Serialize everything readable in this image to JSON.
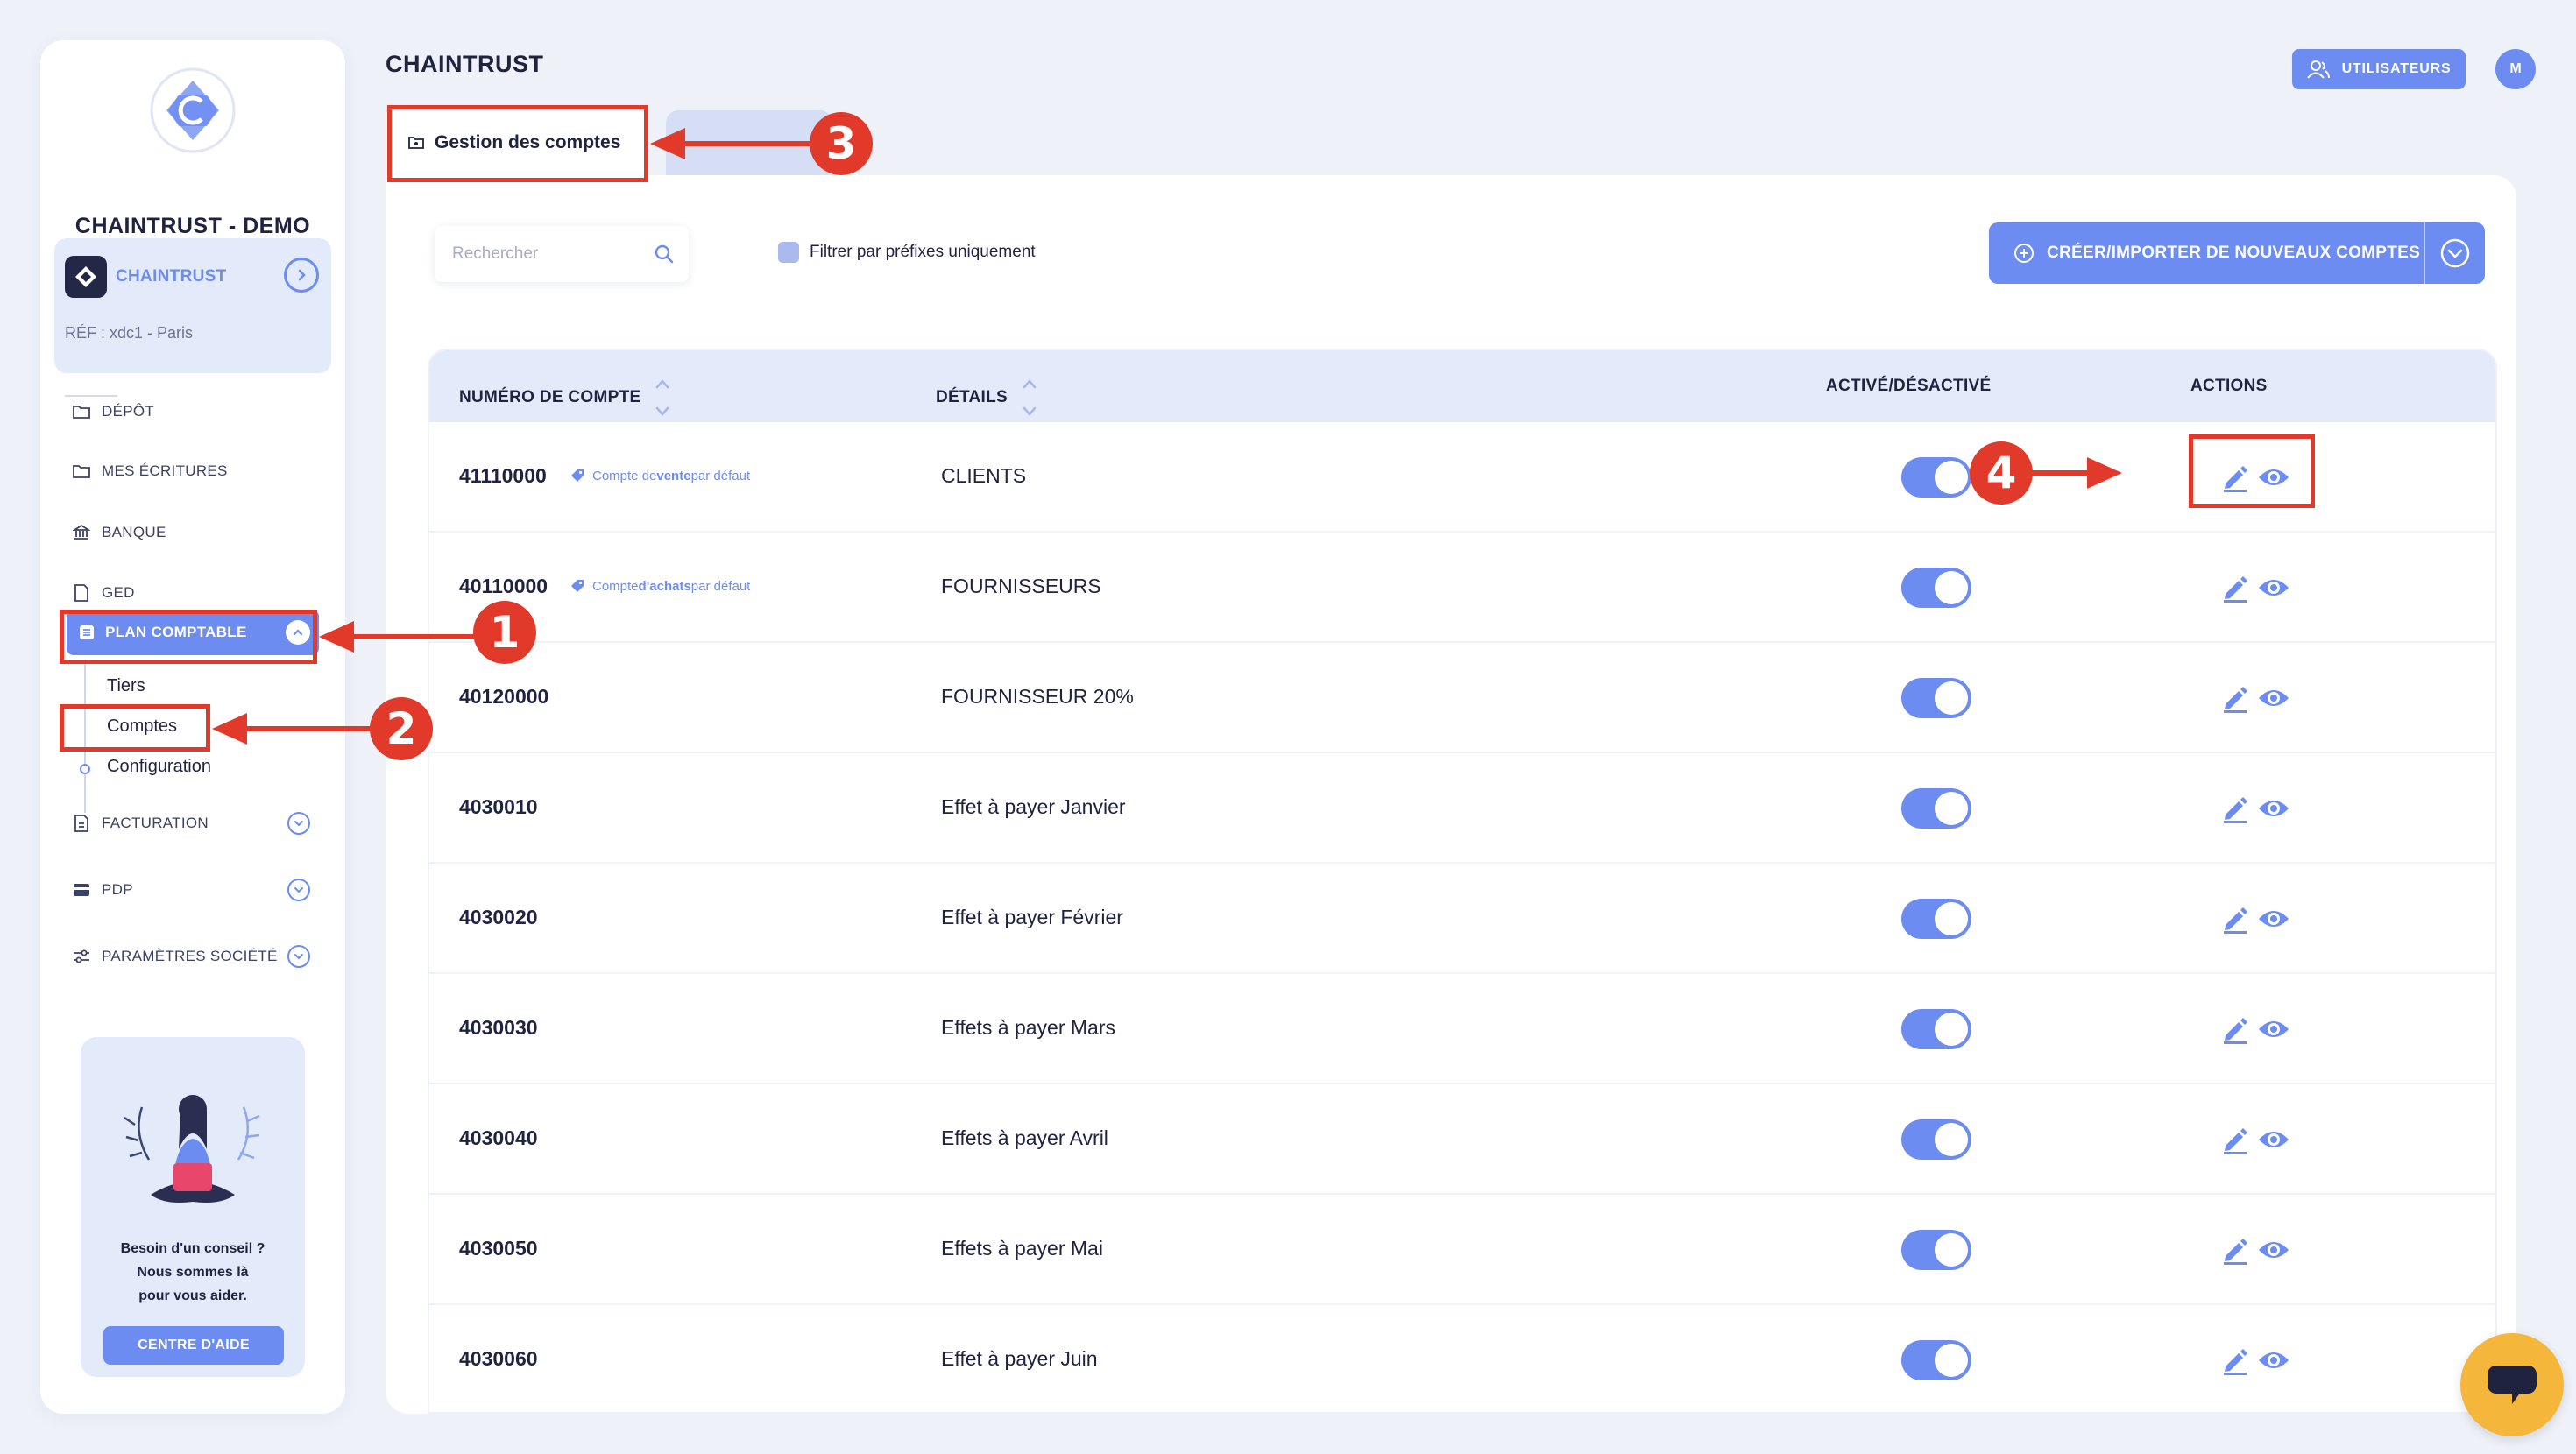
{
  "sidebar": {
    "company_name": "CHAINTRUST - DEMO",
    "org": {
      "name": "CHAINTRUST",
      "ref": "RÉF : xdc1 - Paris"
    },
    "nav": [
      {
        "label": "DÉPÔT",
        "icon": "folder-icon"
      },
      {
        "label": "MES ÉCRITURES",
        "icon": "folder-icon"
      },
      {
        "label": "BANQUE",
        "icon": "bank-icon"
      },
      {
        "label": "GED",
        "icon": "document-icon"
      },
      {
        "label": "PLAN COMPTABLE",
        "icon": "ledger-icon"
      },
      {
        "label": "FACTURATION",
        "icon": "invoice-icon"
      },
      {
        "label": "PDP",
        "icon": "card-icon"
      },
      {
        "label": "PARAMÈTRES SOCIÉTÉ",
        "icon": "sliders-icon"
      }
    ],
    "sub_items": [
      "Tiers",
      "Comptes",
      "Configuration"
    ],
    "help": {
      "line1": "Besoin d'un conseil ?",
      "line2": "Nous sommes là",
      "line3": "pour vous aider.",
      "button": "CENTRE D'AIDE"
    }
  },
  "header": {
    "title": "CHAINTRUST",
    "users_button": "UTILISATEURS",
    "avatar_initial": "M"
  },
  "tabs": {
    "active": "Gestion des comptes"
  },
  "toolbar": {
    "search_placeholder": "Rechercher",
    "filter_label": "Filtrer par préfixes uniquement",
    "create_button": "CRÉER/IMPORTER DE NOUVEAUX COMPTES"
  },
  "table": {
    "headers": {
      "account_number": "NUMÉRO DE COMPTE",
      "details": "DÉTAILS",
      "active": "ACTIVÉ/DÉSACTIVÉ",
      "actions": "ACTIONS"
    },
    "rows": [
      {
        "number": "41110000",
        "tag_prefix": "Compte de ",
        "tag_bold": "vente",
        "tag_suffix": " par défaut",
        "details": "CLIENTS",
        "active": true
      },
      {
        "number": "40110000",
        "tag_prefix": "Compte ",
        "tag_bold": "d'achats",
        "tag_suffix": " par défaut",
        "details": "FOURNISSEURS",
        "active": true
      },
      {
        "number": "40120000",
        "details": "FOURNISSEUR 20%",
        "active": true
      },
      {
        "number": "4030010",
        "details": "Effet à payer Janvier",
        "active": true
      },
      {
        "number": "4030020",
        "details": "Effet à payer Février",
        "active": true
      },
      {
        "number": "4030030",
        "details": "Effets à payer Mars",
        "active": true
      },
      {
        "number": "4030040",
        "details": "Effets à payer Avril",
        "active": true
      },
      {
        "number": "4030050",
        "details": "Effets à payer Mai",
        "active": true
      },
      {
        "number": "4030060",
        "details": "Effet à payer Juin",
        "active": true
      }
    ]
  },
  "annotations": [
    "1",
    "2",
    "3",
    "4"
  ],
  "colors": {
    "accent": "#6c8cf2",
    "annotation_red": "#e23a2a",
    "chat_yellow": "#f5b73b"
  }
}
